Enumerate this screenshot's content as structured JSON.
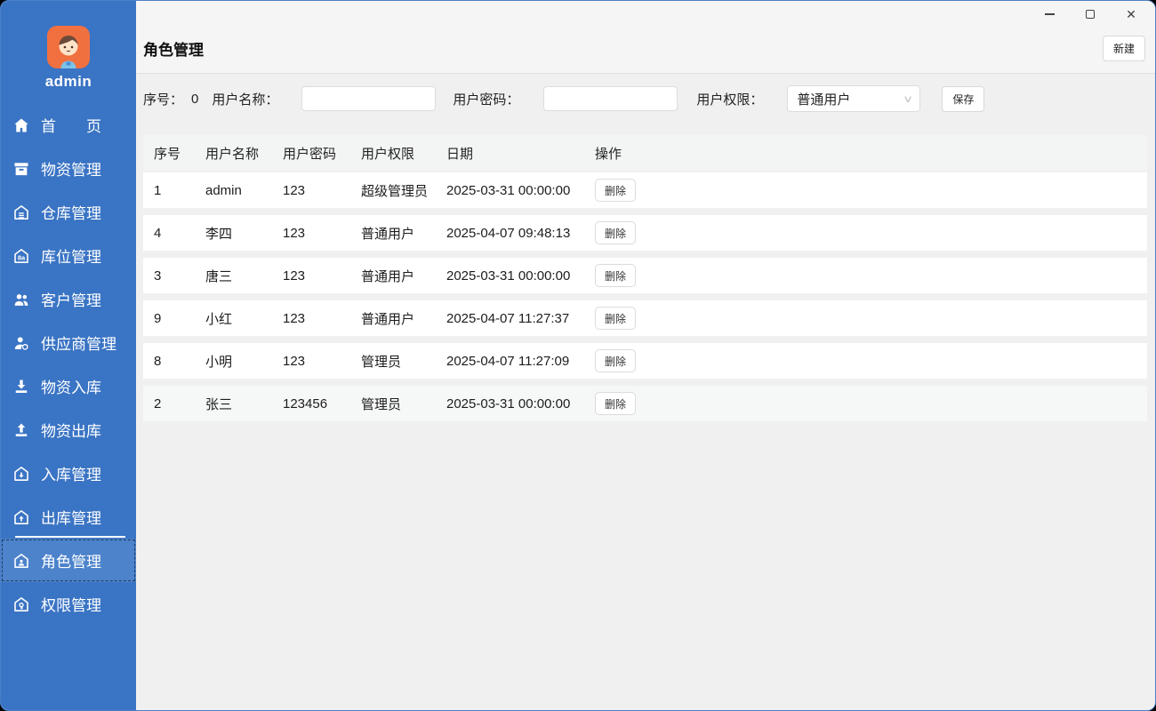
{
  "sidebar": {
    "username": "admin",
    "items": [
      {
        "key": "home",
        "label": "首页",
        "icon": "home-icon",
        "selected": false
      },
      {
        "key": "materials",
        "label": "物资管理",
        "icon": "materials-icon",
        "selected": false
      },
      {
        "key": "warehouse",
        "label": "仓库管理",
        "icon": "warehouse-icon",
        "selected": false
      },
      {
        "key": "location",
        "label": "库位管理",
        "icon": "location-icon",
        "selected": false
      },
      {
        "key": "customers",
        "label": "客户管理",
        "icon": "customers-icon",
        "selected": false
      },
      {
        "key": "suppliers",
        "label": "供应商管理",
        "icon": "suppliers-icon",
        "selected": false
      },
      {
        "key": "material-in",
        "label": "物资入库",
        "icon": "material-in-icon",
        "selected": false
      },
      {
        "key": "material-out",
        "label": "物资出库",
        "icon": "material-out-icon",
        "selected": false
      },
      {
        "key": "inbound-mgmt",
        "label": "入库管理",
        "icon": "inbound-mgmt-icon",
        "selected": false
      },
      {
        "key": "outbound-mgmt",
        "label": "出库管理",
        "icon": "outbound-mgmt-icon",
        "selected": false
      },
      {
        "key": "role-mgmt",
        "label": "角色管理",
        "icon": "role-mgmt-icon",
        "selected": true
      },
      {
        "key": "permission-mgmt",
        "label": "权限管理",
        "icon": "permission-mgmt-icon",
        "selected": false
      }
    ]
  },
  "header": {
    "title": "角色管理",
    "new_button": "新建"
  },
  "form": {
    "serial_label": "序号：",
    "serial_value": "0",
    "name_label": "用户名称：",
    "name_value": "",
    "password_label": "用户密码：",
    "password_value": "",
    "permission_label": "用户权限：",
    "permission_value": "普通用户",
    "save_button": "保存"
  },
  "table": {
    "columns": [
      "序号",
      "用户名称",
      "用户密码",
      "用户权限",
      "日期",
      "操作"
    ],
    "delete_button": "删除",
    "rows": [
      {
        "id": "1",
        "name": "admin",
        "password": "123",
        "permission": "超级管理员",
        "date": "2025-03-31 00:00:00"
      },
      {
        "id": "4",
        "name": "李四",
        "password": "123",
        "permission": "普通用户",
        "date": "2025-04-07 09:48:13"
      },
      {
        "id": "3",
        "name": "唐三",
        "password": "123",
        "permission": "普通用户",
        "date": "2025-03-31 00:00:00"
      },
      {
        "id": "9",
        "name": "小红",
        "password": "123",
        "permission": "普通用户",
        "date": "2025-04-07 11:27:37"
      },
      {
        "id": "8",
        "name": "小明",
        "password": "123",
        "permission": "管理员",
        "date": "2025-04-07 11:27:09"
      },
      {
        "id": "2",
        "name": "张三",
        "password": "123456",
        "permission": "管理员",
        "date": "2025-03-31 00:00:00"
      }
    ]
  },
  "colors": {
    "sidebar_blue": "#3A74C4",
    "sidebar_selected": "#4C83CB",
    "avatar_orange": "#F1703F",
    "page_background": "#F0F0F0",
    "titlebar_background": "#F5F5F5"
  }
}
